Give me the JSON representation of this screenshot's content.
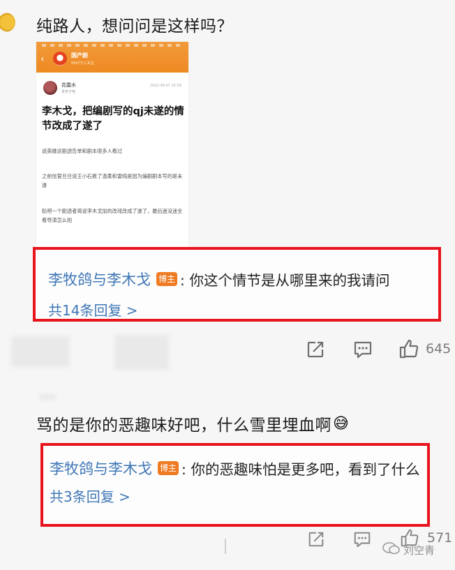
{
  "top_comment": {
    "text": "纯路人，想问问是这样吗？"
  },
  "embed": {
    "header_name": "国产剧",
    "header_sub": "8997万人关注",
    "user_name": "花露水",
    "user_meta": "发布于吧",
    "date": "2022-09-07 15:58",
    "title": "李木戈，把编剧写的qj未遂的情节改成了遂了",
    "paragraphs": [
      "说英雄这剧透告单和剧本很多人看过",
      "之前信誓旦旦说王小石救了温柔和雷纯是因为编剧剧本写的是未遂",
      "贴吧一个剧透者哥说李木戈加的改戏改成了遂了，最后迷没迷全看导演怎么拍"
    ]
  },
  "reply1": {
    "user": "李牧鸽与李木戈",
    "badge": "博主",
    "text": ": 你这个情节是从哪里来的我请问",
    "more": "共14条回复 >"
  },
  "actions1": {
    "like_count": "645"
  },
  "second_comment": {
    "text": "骂的是你的恶趣味好吧，什么雪里埋血啊",
    "emoji": "😅"
  },
  "reply2": {
    "user": "李牧鸽与李木戈",
    "badge": "博主",
    "text": ": 你的恶趣味怕是更多吧，看到了什么",
    "more": "共3条回复 >"
  },
  "actions2": {
    "like_count": "571"
  },
  "watermark": {
    "text": "刘空青"
  },
  "colors": {
    "highlight": "#e8131c",
    "link": "#3f77b6",
    "badge": "#ee7b22",
    "header": "#ef8f29"
  }
}
